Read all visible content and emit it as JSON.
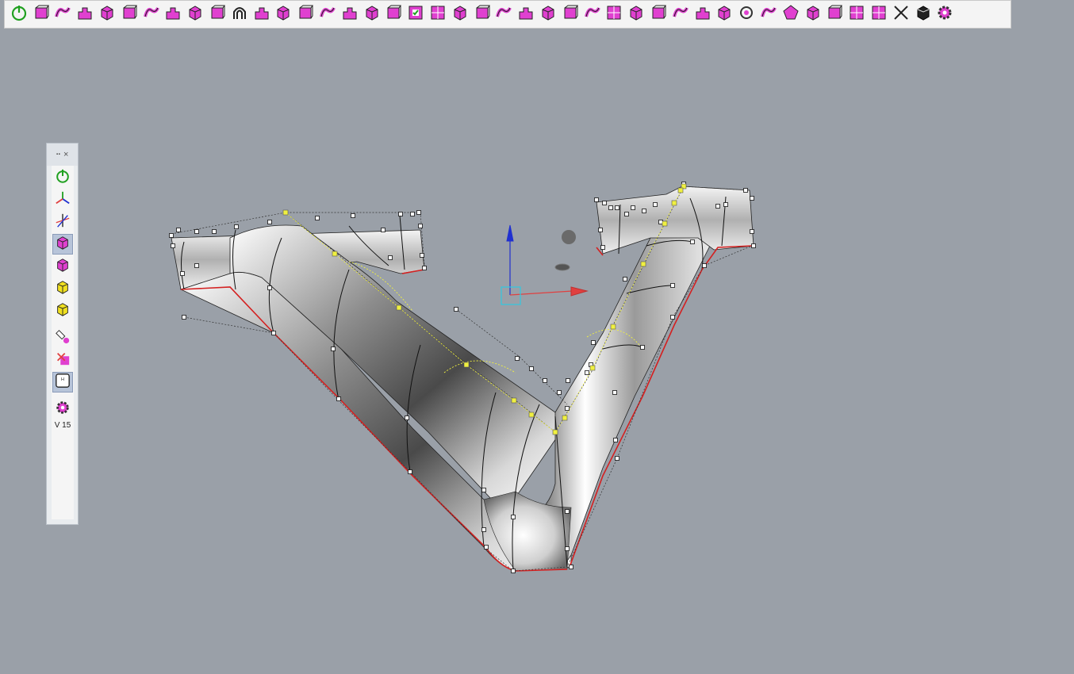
{
  "toolbar": {
    "buttons": [
      {
        "name": "power-icon"
      },
      {
        "name": "box-object-icon"
      },
      {
        "name": "sphere-object-icon"
      },
      {
        "name": "blob-shape-icon"
      },
      {
        "name": "bridge-object-icon"
      },
      {
        "name": "cage-box-icon"
      },
      {
        "name": "curve-arrow-icon"
      },
      {
        "name": "pipe-bend-icon"
      },
      {
        "name": "rotate-square-icon"
      },
      {
        "name": "fold-plane-icon"
      },
      {
        "name": "arch-icon"
      },
      {
        "name": "twist-icon"
      },
      {
        "name": "step-shape-icon"
      },
      {
        "name": "add-column-icon"
      },
      {
        "name": "add-grid-icon"
      },
      {
        "name": "crease-cube-icon"
      },
      {
        "name": "flow-shape-icon"
      },
      {
        "name": "connect-bridge-icon"
      },
      {
        "name": "check-face-icon"
      },
      {
        "name": "grid-face-icon"
      },
      {
        "name": "rotate-face-icon"
      },
      {
        "name": "delete-grid-icon"
      },
      {
        "name": "stair-icon"
      },
      {
        "name": "stair-split-icon"
      },
      {
        "name": "bridge-gap-icon"
      },
      {
        "name": "undo-shape-icon"
      },
      {
        "name": "barrel-icon"
      },
      {
        "name": "dot-grid-icon"
      },
      {
        "name": "bend-curve-icon"
      },
      {
        "name": "hand-select-icon"
      },
      {
        "name": "edge-arrow-icon"
      },
      {
        "name": "branch-icon"
      },
      {
        "name": "checker-diamond-icon"
      },
      {
        "name": "target-icon"
      },
      {
        "name": "star-rotate-icon"
      },
      {
        "name": "pentagon-icon"
      },
      {
        "name": "comb-icon"
      },
      {
        "name": "wave-panel-icon"
      },
      {
        "name": "mesh-panel-icon"
      },
      {
        "name": "tile-panel-icon"
      },
      {
        "name": "scissors-icon"
      },
      {
        "name": "cube-solid-icon"
      },
      {
        "name": "gear-icon"
      }
    ]
  },
  "side_panel": {
    "title_grip": "··",
    "close_glyph": "×",
    "buttons": [
      {
        "name": "power-icon",
        "active": false
      },
      {
        "name": "axis-gizmo-icon",
        "active": false
      },
      {
        "name": "move-gizmo-icon",
        "active": false
      },
      {
        "name": "subd-box-icon",
        "active": true
      },
      {
        "name": "subd-box-alt-icon",
        "active": false
      },
      {
        "name": "yellow-box-icon",
        "active": false
      },
      {
        "name": "yellow-box-alt-icon",
        "active": false
      },
      {
        "name": "brush-icon",
        "active": false
      },
      {
        "name": "no-brush-icon",
        "active": false
      },
      {
        "name": "h-key-icon",
        "active": true
      },
      {
        "name": "gear-icon",
        "active": false
      }
    ],
    "version": "V 15"
  },
  "colors": {
    "background": "#9aa0a8",
    "accent_magenta": "#e040d0",
    "toolbar_bg": "#f4f4f4",
    "edge_red": "#d42020",
    "gizmo_blue": "#2030d0",
    "gizmo_red": "#e04040",
    "gizmo_cyan": "#30c8e0",
    "control_yellow": "#f0f040"
  }
}
